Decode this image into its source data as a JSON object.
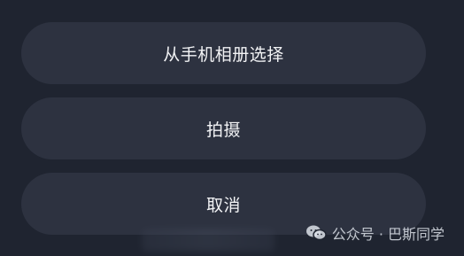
{
  "actions": {
    "choose_from_album": "从手机相册选择",
    "take_photo": "拍摄",
    "cancel": "取消"
  },
  "watermark": {
    "text": "公众号 · 巴斯同学",
    "icon": "wechat-icon"
  }
}
